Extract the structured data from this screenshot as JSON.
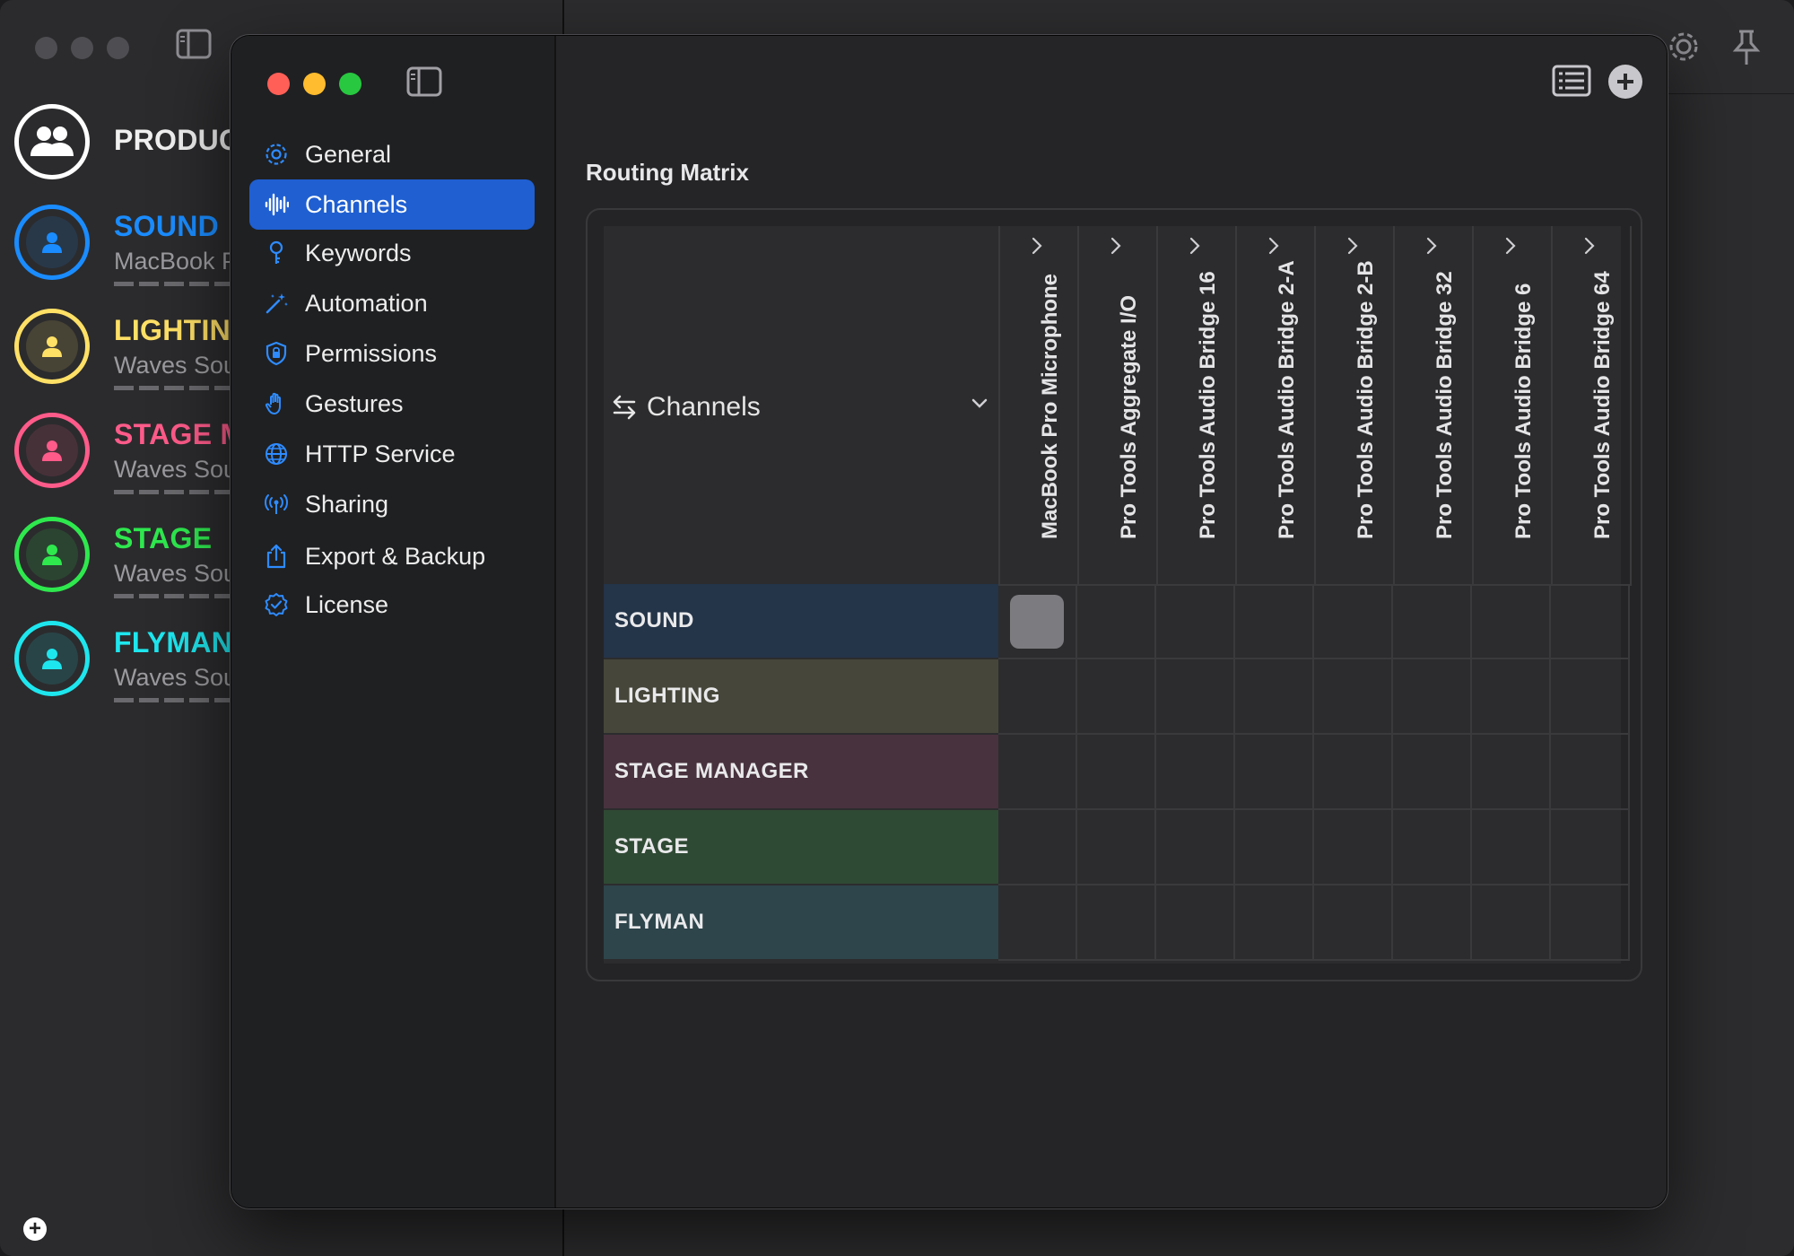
{
  "background_window": {
    "header_title": "PRODUC",
    "members": [
      {
        "name": "SOUND",
        "subtitle": "MacBook P",
        "color": "#1a8cff"
      },
      {
        "name": "LIGHTING",
        "subtitle": "Waves Sou",
        "color": "#ffe066"
      },
      {
        "name": "STAGE M",
        "subtitle": "Waves Sou",
        "color": "#ff5b8a"
      },
      {
        "name": "STAGE",
        "subtitle": "Waves Sou",
        "color": "#2ee84e"
      },
      {
        "name": "FLYMAN",
        "subtitle": "Waves Sou",
        "color": "#1ee6ee"
      }
    ],
    "add_label": "+"
  },
  "settings": {
    "traffic_lights": {
      "close": "#ff5f57",
      "minimize": "#febc2e",
      "zoom": "#28c840"
    },
    "nav": [
      {
        "label": "General",
        "icon": "gear-icon"
      },
      {
        "label": "Channels",
        "icon": "waveform-icon",
        "active": true
      },
      {
        "label": "Keywords",
        "icon": "key-icon"
      },
      {
        "label": "Automation",
        "icon": "magic-wand-icon"
      },
      {
        "label": "Permissions",
        "icon": "lock-shield-icon"
      },
      {
        "label": "Gestures",
        "icon": "hand-icon"
      },
      {
        "label": "HTTP Service",
        "icon": "globe-icon"
      },
      {
        "label": "Sharing",
        "icon": "broadcast-icon"
      },
      {
        "label": "Export & Backup",
        "icon": "share-icon"
      },
      {
        "label": "License",
        "icon": "checkmark-seal-icon"
      }
    ],
    "section_title": "Routing Matrix",
    "matrix": {
      "selector_label": "Channels",
      "columns": [
        "MacBook Pro Microphone",
        "Pro Tools Aggregate I/O",
        "Pro Tools Audio Bridge 16",
        "Pro Tools Audio Bridge 2-A",
        "Pro Tools Audio Bridge 2-B",
        "Pro Tools Audio Bridge 32",
        "Pro Tools Audio Bridge 6",
        "Pro Tools Audio Bridge 64"
      ],
      "rows": [
        {
          "label": "SOUND",
          "color": "#243449",
          "active_columns": [
            0
          ]
        },
        {
          "label": "LIGHTING",
          "color": "#46463a",
          "active_columns": []
        },
        {
          "label": "STAGE MANAGER",
          "color": "#48323d",
          "active_columns": []
        },
        {
          "label": "STAGE",
          "color": "#2f4a34",
          "active_columns": []
        },
        {
          "label": "FLYMAN",
          "color": "#2d454b",
          "active_columns": []
        }
      ]
    }
  }
}
